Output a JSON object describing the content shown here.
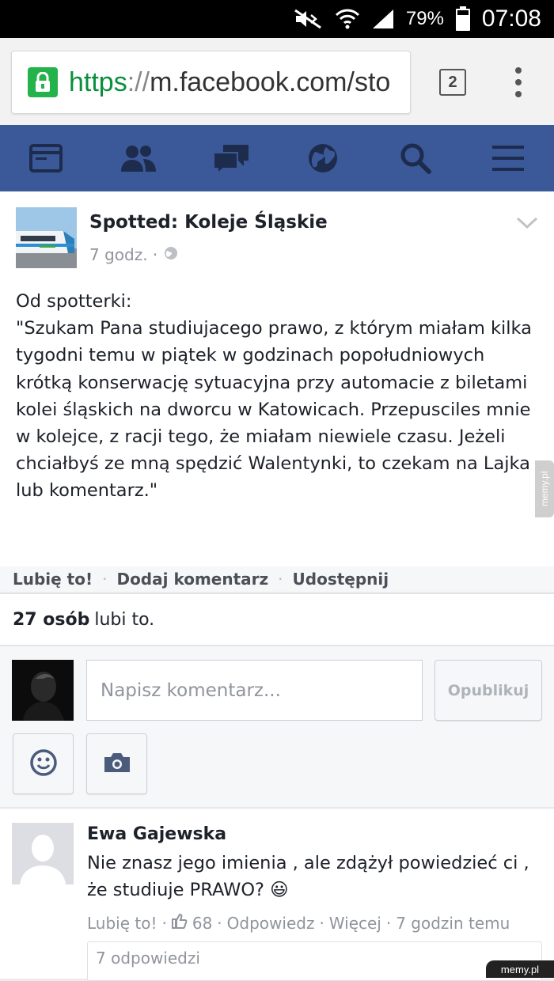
{
  "status_bar": {
    "battery": "79%",
    "time": "07:08",
    "icons": [
      "mute-icon",
      "wifi-icon",
      "signal-icon",
      "battery-icon"
    ]
  },
  "browser": {
    "url_scheme": "https",
    "url_separator": "://",
    "url_rest": "m.facebook.com/sto",
    "tab_count": "2"
  },
  "fb_nav": {
    "items": [
      "news-feed-icon",
      "friends-icon",
      "messages-icon",
      "notifications-globe-icon",
      "search-icon",
      "menu-icon"
    ]
  },
  "post": {
    "page_name": "Spotted: Koleje Śląskie",
    "time": "7 godz. ·",
    "text": "Od spotterki:\n\"Szukam Pana studiujacego prawo, z którym miałam kilka tygodni temu w piątek w godzinach popołudniowych krótką konserwację sytuacyjna przy automacie z biletami kolei śląskich na dworcu w Katowicach. Przepusciles mnie w kolejce, z racji tego, że miałam niewiele czasu. Jeżeli chciałbyś ze mną spędzić Walentynki, to czekam na Lajka lub komentarz.\"",
    "actions": {
      "like": "Lubię to!",
      "comment": "Dodaj komentarz",
      "share": "Udostępnij"
    },
    "likes_count": "27 osób",
    "likes_suffix": "lubi to."
  },
  "composer": {
    "placeholder": "Napisz komentarz...",
    "publish": "Opublikuj"
  },
  "comment": {
    "author": "Ewa Gajewska",
    "text": "Nie znasz jego imienia , ale zdążył powiedzieć ci , że studiuje PRAWO? 😃",
    "like_label": "Lubię to!",
    "like_count": "68",
    "reply_label": "Odpowiedz",
    "more_label": "Więcej",
    "time": "7 godzin temu",
    "replies_label": "7 odpowiedzi",
    "sep": "·"
  },
  "watermark": {
    "side": "memy.pl",
    "corner": "memy.pl"
  },
  "colors": {
    "fb_blue": "#3b5998",
    "https_green": "#0a8f3b",
    "lock_green": "#24b24b"
  }
}
